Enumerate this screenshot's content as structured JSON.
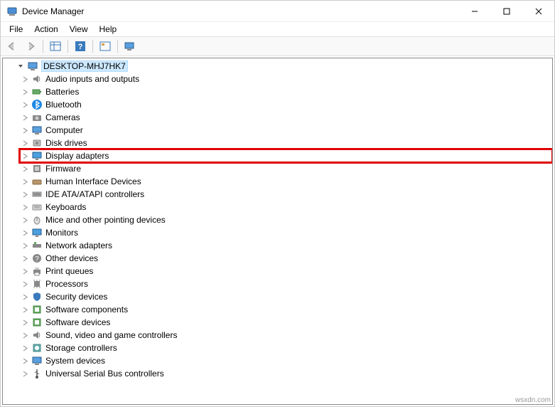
{
  "window": {
    "title": "Device Manager"
  },
  "menubar": [
    "File",
    "Action",
    "View",
    "Help"
  ],
  "root": {
    "label": "DESKTOP-MHJ7HK7"
  },
  "categories": [
    {
      "label": "Audio inputs and outputs",
      "icon": "speaker",
      "highlighted": false
    },
    {
      "label": "Batteries",
      "icon": "battery",
      "highlighted": false
    },
    {
      "label": "Bluetooth",
      "icon": "bluetooth",
      "highlighted": false
    },
    {
      "label": "Cameras",
      "icon": "camera",
      "highlighted": false
    },
    {
      "label": "Computer",
      "icon": "computer",
      "highlighted": false
    },
    {
      "label": "Disk drives",
      "icon": "disk",
      "highlighted": false
    },
    {
      "label": "Display adapters",
      "icon": "display",
      "highlighted": true
    },
    {
      "label": "Firmware",
      "icon": "firmware",
      "highlighted": false
    },
    {
      "label": "Human Interface Devices",
      "icon": "hid",
      "highlighted": false
    },
    {
      "label": "IDE ATA/ATAPI controllers",
      "icon": "ide",
      "highlighted": false
    },
    {
      "label": "Keyboards",
      "icon": "keyboard",
      "highlighted": false
    },
    {
      "label": "Mice and other pointing devices",
      "icon": "mouse",
      "highlighted": false
    },
    {
      "label": "Monitors",
      "icon": "monitor",
      "highlighted": false
    },
    {
      "label": "Network adapters",
      "icon": "network",
      "highlighted": false
    },
    {
      "label": "Other devices",
      "icon": "other",
      "highlighted": false
    },
    {
      "label": "Print queues",
      "icon": "printer",
      "highlighted": false
    },
    {
      "label": "Processors",
      "icon": "cpu",
      "highlighted": false
    },
    {
      "label": "Security devices",
      "icon": "security",
      "highlighted": false
    },
    {
      "label": "Software components",
      "icon": "software",
      "highlighted": false
    },
    {
      "label": "Software devices",
      "icon": "software",
      "highlighted": false
    },
    {
      "label": "Sound, video and game controllers",
      "icon": "sound",
      "highlighted": false
    },
    {
      "label": "Storage controllers",
      "icon": "storage",
      "highlighted": false
    },
    {
      "label": "System devices",
      "icon": "system",
      "highlighted": false
    },
    {
      "label": "Universal Serial Bus controllers",
      "icon": "usb",
      "highlighted": false
    }
  ],
  "watermark": "wsxdn.com"
}
